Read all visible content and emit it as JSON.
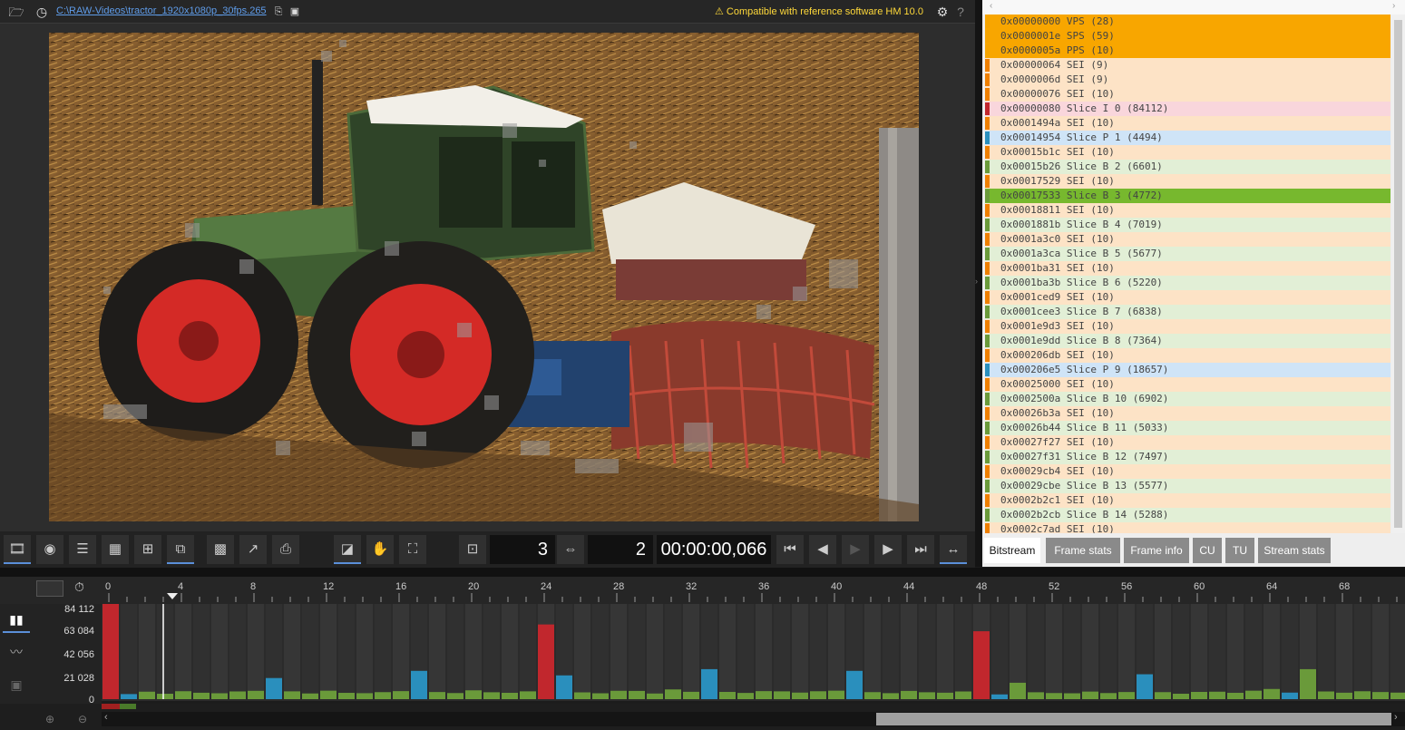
{
  "topbar": {
    "file_path": "C:\\RAW-Videos\\tractor_1920x1080p_30fps.265",
    "compat": "Compatible with reference software HM 10.0"
  },
  "controls": {
    "pic_num": "3",
    "frame_num": "2",
    "time": "00:00:00,066"
  },
  "nal_units": [
    {
      "text": "0x00000000 VPS (28)",
      "kind": "param",
      "highlight": true
    },
    {
      "text": "0x0000001e SPS (59)",
      "kind": "param",
      "highlight": true
    },
    {
      "text": "0x0000005a PPS (10)",
      "kind": "param",
      "highlight": true
    },
    {
      "text": "0x00000064 SEI (9)",
      "kind": "sei"
    },
    {
      "text": "0x0000006d SEI (9)",
      "kind": "sei"
    },
    {
      "text": "0x00000076 SEI (10)",
      "kind": "sei"
    },
    {
      "text": "0x00000080 Slice I 0 (84112)",
      "kind": "I"
    },
    {
      "text": "0x0001494a SEI (10)",
      "kind": "sei"
    },
    {
      "text": "0x00014954 Slice P 1 (4494)",
      "kind": "P"
    },
    {
      "text": "0x00015b1c SEI (10)",
      "kind": "sei"
    },
    {
      "text": "0x00015b26 Slice B 2 (6601)",
      "kind": "B"
    },
    {
      "text": "0x00017529 SEI (10)",
      "kind": "sei"
    },
    {
      "text": "0x00017533 Slice B 3 (4772)",
      "kind": "B",
      "highlight": true
    },
    {
      "text": "0x00018811 SEI (10)",
      "kind": "sei"
    },
    {
      "text": "0x0001881b Slice B 4 (7019)",
      "kind": "B"
    },
    {
      "text": "0x0001a3c0 SEI (10)",
      "kind": "sei"
    },
    {
      "text": "0x0001a3ca Slice B 5 (5677)",
      "kind": "B"
    },
    {
      "text": "0x0001ba31 SEI (10)",
      "kind": "sei"
    },
    {
      "text": "0x0001ba3b Slice B 6 (5220)",
      "kind": "B"
    },
    {
      "text": "0x0001ced9 SEI (10)",
      "kind": "sei"
    },
    {
      "text": "0x0001cee3 Slice B 7 (6838)",
      "kind": "B"
    },
    {
      "text": "0x0001e9d3 SEI (10)",
      "kind": "sei"
    },
    {
      "text": "0x0001e9dd Slice B 8 (7364)",
      "kind": "B"
    },
    {
      "text": "0x000206db SEI (10)",
      "kind": "sei"
    },
    {
      "text": "0x000206e5 Slice P 9 (18657)",
      "kind": "P"
    },
    {
      "text": "0x00025000 SEI (10)",
      "kind": "sei"
    },
    {
      "text": "0x0002500a Slice B 10 (6902)",
      "kind": "B"
    },
    {
      "text": "0x00026b3a SEI (10)",
      "kind": "sei"
    },
    {
      "text": "0x00026b44 Slice B 11 (5033)",
      "kind": "B"
    },
    {
      "text": "0x00027f27 SEI (10)",
      "kind": "sei"
    },
    {
      "text": "0x00027f31 Slice B 12 (7497)",
      "kind": "B"
    },
    {
      "text": "0x00029cb4 SEI (10)",
      "kind": "sei"
    },
    {
      "text": "0x00029cbe Slice B 13 (5577)",
      "kind": "B"
    },
    {
      "text": "0x0002b2c1 SEI (10)",
      "kind": "sei"
    },
    {
      "text": "0x0002b2cb Slice B 14 (5288)",
      "kind": "B"
    },
    {
      "text": "0x0002c7ad SEI (10)",
      "kind": "sei"
    }
  ],
  "tabs": [
    "Bitstream",
    "Frame stats",
    "Frame info",
    "CU",
    "TU",
    "Stream stats"
  ],
  "colors": {
    "I": "#c1272d",
    "P": "#2a8fbd",
    "B": "#6a9a3a",
    "sei": "#ee7f00",
    "param": "#f5a400"
  },
  "chart_data": {
    "type": "bar",
    "x": [
      0,
      1,
      2,
      3,
      4,
      5,
      6,
      7,
      8,
      9,
      10,
      11,
      12,
      13,
      14,
      15,
      16,
      17,
      18,
      19,
      20,
      21,
      22,
      23,
      24,
      25,
      26,
      27,
      28,
      29,
      30,
      31,
      32,
      33,
      34,
      35,
      36,
      37,
      38,
      39,
      40,
      41,
      42,
      43,
      44,
      45,
      46,
      47,
      48,
      49,
      50,
      51,
      52,
      53,
      54,
      55,
      56,
      57,
      58,
      59,
      60,
      61,
      62,
      63,
      64,
      65,
      66,
      67,
      68,
      69,
      70,
      71
    ],
    "frame_types": [
      "I",
      "P",
      "B",
      "B",
      "B",
      "B",
      "B",
      "B",
      "B",
      "P",
      "B",
      "B",
      "B",
      "B",
      "B",
      "B",
      "B",
      "P",
      "B",
      "B",
      "B",
      "B",
      "B",
      "B",
      "I",
      "P",
      "B",
      "B",
      "B",
      "B",
      "B",
      "B",
      "B",
      "P",
      "B",
      "B",
      "B",
      "B",
      "B",
      "B",
      "B",
      "P",
      "B",
      "B",
      "B",
      "B",
      "B",
      "B",
      "I",
      "P",
      "B",
      "B",
      "B",
      "B",
      "B",
      "B",
      "B",
      "P",
      "B",
      "B",
      "B",
      "B",
      "B",
      "B",
      "B",
      "P",
      "B",
      "B",
      "B",
      "B",
      "B",
      "B"
    ],
    "values": [
      84112,
      4494,
      6601,
      4772,
      7019,
      5677,
      5220,
      6838,
      7364,
      18657,
      6902,
      5033,
      7497,
      5577,
      5288,
      6200,
      7100,
      25000,
      6300,
      5400,
      7800,
      6100,
      5600,
      6900,
      66000,
      21000,
      6000,
      5200,
      7400,
      7300,
      5000,
      8600,
      6500,
      26500,
      6400,
      5500,
      7100,
      6900,
      5800,
      7000,
      7500,
      25000,
      6200,
      5300,
      7300,
      6100,
      5700,
      6800,
      60000,
      4200,
      14500,
      6100,
      5400,
      5200,
      6700,
      5400,
      6300,
      22000,
      6200,
      4800,
      6400,
      6600,
      5600,
      7500,
      9000,
      5800,
      26500,
      6800,
      5700,
      7000,
      6300,
      5800
    ],
    "yticks": [
      "84 112",
      "63 084",
      "42 056",
      "21 028",
      "0"
    ],
    "xticks": [
      0,
      4,
      8,
      12,
      16,
      20,
      24,
      28,
      32,
      36,
      40,
      44,
      48,
      52,
      56,
      60,
      64,
      68
    ],
    "ylim": [
      0,
      84112
    ],
    "current_frame": 3
  }
}
